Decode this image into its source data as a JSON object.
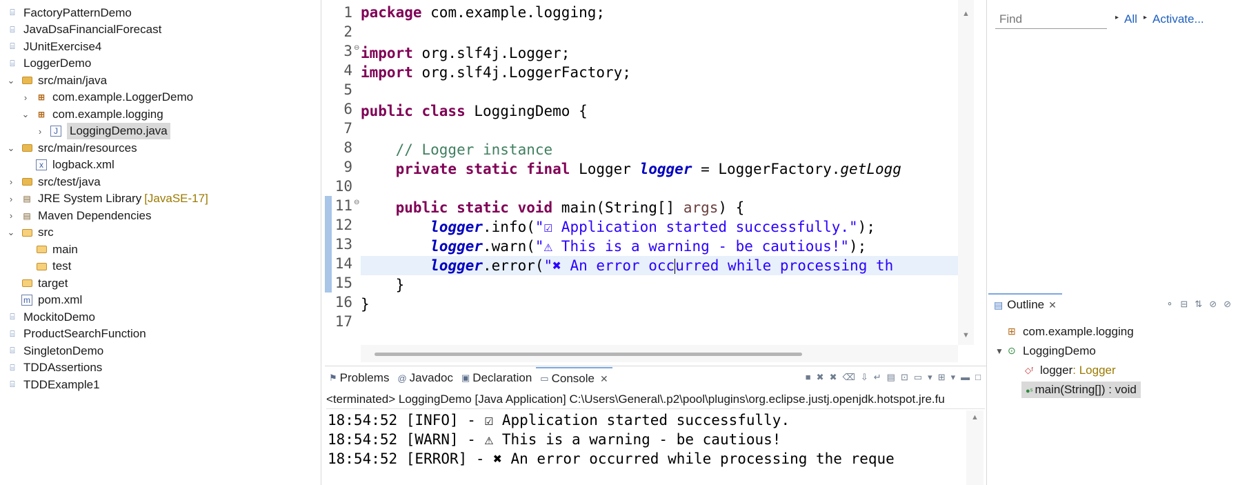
{
  "explorer": {
    "items": [
      {
        "label": "FactoryPatternDemo",
        "icon": "project-icon",
        "chev": ">",
        "indent": 0
      },
      {
        "label": "JavaDsaFinancialForecast",
        "icon": "project-icon",
        "chev": ">",
        "indent": 0
      },
      {
        "label": "JUnitExercise4",
        "icon": "project-icon",
        "chev": ">",
        "indent": 0
      },
      {
        "label": "LoggerDemo",
        "icon": "project-icon",
        "chev": "v",
        "indent": 0
      },
      {
        "label": "src/main/java",
        "icon": "source-folder-icon",
        "chev": "v",
        "indent": 1
      },
      {
        "label": "com.example.LoggerDemo",
        "icon": "package-icon",
        "chev": ">",
        "indent": 2
      },
      {
        "label": "com.example.logging",
        "icon": "package-icon",
        "chev": "v",
        "indent": 2
      },
      {
        "label": "LoggingDemo.java",
        "icon": "java-file-icon",
        "chev": ">",
        "indent": 3
      },
      {
        "label": "src/main/resources",
        "icon": "source-folder-icon",
        "chev": "v",
        "indent": 1
      },
      {
        "label": "logback.xml",
        "icon": "xml-file-icon",
        "chev": "",
        "indent": 2
      },
      {
        "label": "src/test/java",
        "icon": "source-folder-icon",
        "chev": ">",
        "indent": 1
      },
      {
        "label": "JRE System Library",
        "tag": "[JavaSE-17]",
        "icon": "library-icon",
        "chev": ">",
        "indent": 1
      },
      {
        "label": "Maven Dependencies",
        "icon": "library-icon",
        "chev": ">",
        "indent": 1
      },
      {
        "label": "src",
        "icon": "folder-icon",
        "chev": "v",
        "indent": 1
      },
      {
        "label": "main",
        "icon": "folder-icon",
        "chev": "",
        "indent": 2
      },
      {
        "label": "test",
        "icon": "folder-icon",
        "chev": "",
        "indent": 2
      },
      {
        "label": "target",
        "icon": "folder-icon",
        "chev": "",
        "indent": 1
      },
      {
        "label": "pom.xml",
        "icon": "maven-file-icon",
        "chev": "",
        "indent": 1
      },
      {
        "label": "MockitoDemo",
        "icon": "project-icon",
        "chev": ">",
        "indent": 0
      },
      {
        "label": "ProductSearchFunction",
        "icon": "project-icon",
        "chev": ">",
        "indent": 0
      },
      {
        "label": "SingletonDemo",
        "icon": "project-icon",
        "chev": ">",
        "indent": 0
      },
      {
        "label": "TDDAssertions",
        "icon": "project-icon",
        "chev": ">",
        "indent": 0
      },
      {
        "label": "TDDExample1",
        "icon": "project-icon",
        "chev": ">",
        "indent": 0
      }
    ],
    "selected_index": 7
  },
  "editor": {
    "line_numbers": [
      "1",
      "2",
      "3",
      "4",
      "5",
      "6",
      "7",
      "8",
      "9",
      "10",
      "11",
      "12",
      "13",
      "14",
      "15",
      "16",
      "17"
    ],
    "current_line": 14,
    "code": {
      "l1_kw": "package",
      "l1_rest": " com.example.logging;",
      "l3_kw": "import",
      "l3_rest": " org.slf4j.Logger;",
      "l4_kw": "import",
      "l4_rest": " org.slf4j.LoggerFactory;",
      "l6_kw": "public class",
      "l6_rest": " LoggingDemo {",
      "l8_comment": "// Logger instance",
      "l9_kw": "private static final",
      "l9_type": " Logger ",
      "l9_field": "logger",
      "l9_mid": " = LoggerFactory.",
      "l9_method": "getLogg",
      "l11_kw": "public static void",
      "l11_mid": " main(String[] ",
      "l11_param": "args",
      "l11_end": ") {",
      "l12_field": "logger",
      "l12_call": ".info(",
      "l12_str": "\"☑ Application started successfully.\"",
      "l12_end": ");",
      "l13_field": "logger",
      "l13_call": ".warn(",
      "l13_str": "\"⚠ This is a warning - be cautious!\"",
      "l13_end": ");",
      "l14_field": "logger",
      "l14_call": ".error(",
      "l14_str_a": "\"✖ An error occ",
      "l14_str_b": "urred while processing th",
      "l15": "}",
      "l16": "}"
    }
  },
  "find": {
    "placeholder": "Find",
    "all_label": "All",
    "activate_label": "Activate..."
  },
  "outline": {
    "tab_label": "Outline",
    "items": [
      {
        "label": "com.example.logging",
        "icon": "package-icon"
      },
      {
        "label": "LoggingDemo",
        "icon": "class-icon"
      },
      {
        "label": "logger",
        "type": " : Logger",
        "icon": "field-icon"
      },
      {
        "label": "main(String[]) : void",
        "icon": "method-icon"
      }
    ]
  },
  "console": {
    "tabs": [
      {
        "label": "Problems",
        "icon": "problems-icon"
      },
      {
        "label": "Javadoc",
        "icon": "javadoc-icon"
      },
      {
        "label": "Declaration",
        "icon": "declaration-icon"
      },
      {
        "label": "Console",
        "icon": "console-icon"
      }
    ],
    "header": "<terminated> LoggingDemo [Java Application] C:\\Users\\General\\.p2\\pool\\plugins\\org.eclipse.justj.openjdk.hotspot.jre.fu",
    "lines": [
      "18:54:52 [INFO] - ☑ Application started successfully.",
      "18:54:52 [WARN] - ⚠ This is a warning - be cautious!",
      "18:54:52 [ERROR] - ✖ An error occurred while processing the reque"
    ]
  }
}
